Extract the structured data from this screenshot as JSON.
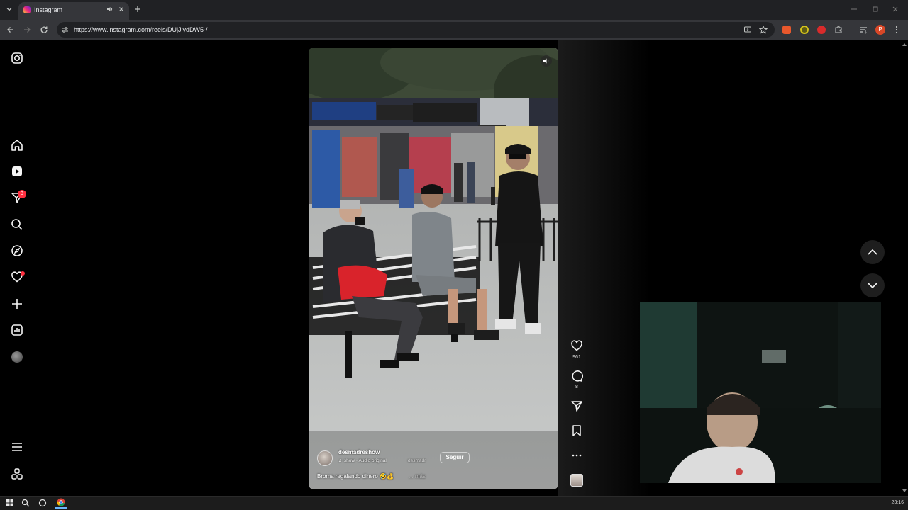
{
  "browser": {
    "tab_title": "Instagram",
    "url": "https://www.instagram.com/reels/DUjJlydDW5-/",
    "profile_initial": "P"
  },
  "sidebar": {
    "items": [
      {
        "name": "instagram-logo-icon"
      },
      {
        "name": "home-icon"
      },
      {
        "name": "reels-icon"
      },
      {
        "name": "messages-icon",
        "badge": "3"
      },
      {
        "name": "search-icon"
      },
      {
        "name": "explore-icon"
      },
      {
        "name": "notifications-icon"
      },
      {
        "name": "create-icon"
      },
      {
        "name": "dashboard-icon"
      },
      {
        "name": "profile-avatar"
      },
      {
        "name": "more-menu-icon"
      },
      {
        "name": "threads-icon"
      }
    ]
  },
  "reel": {
    "author": "desmadreshow",
    "audio": "show · Audio original",
    "audio_tag": "desmadr",
    "follow_label": "Seguir",
    "caption": "Broma regalando dinero 🤣💰",
    "more_label": "... más",
    "likes": "961",
    "comments": "8"
  },
  "taskbar": {
    "clock": "23:16"
  },
  "colors": {
    "badge": "#ff3040",
    "chrome_bg": "#202124",
    "toolbar_bg": "#35363a"
  }
}
